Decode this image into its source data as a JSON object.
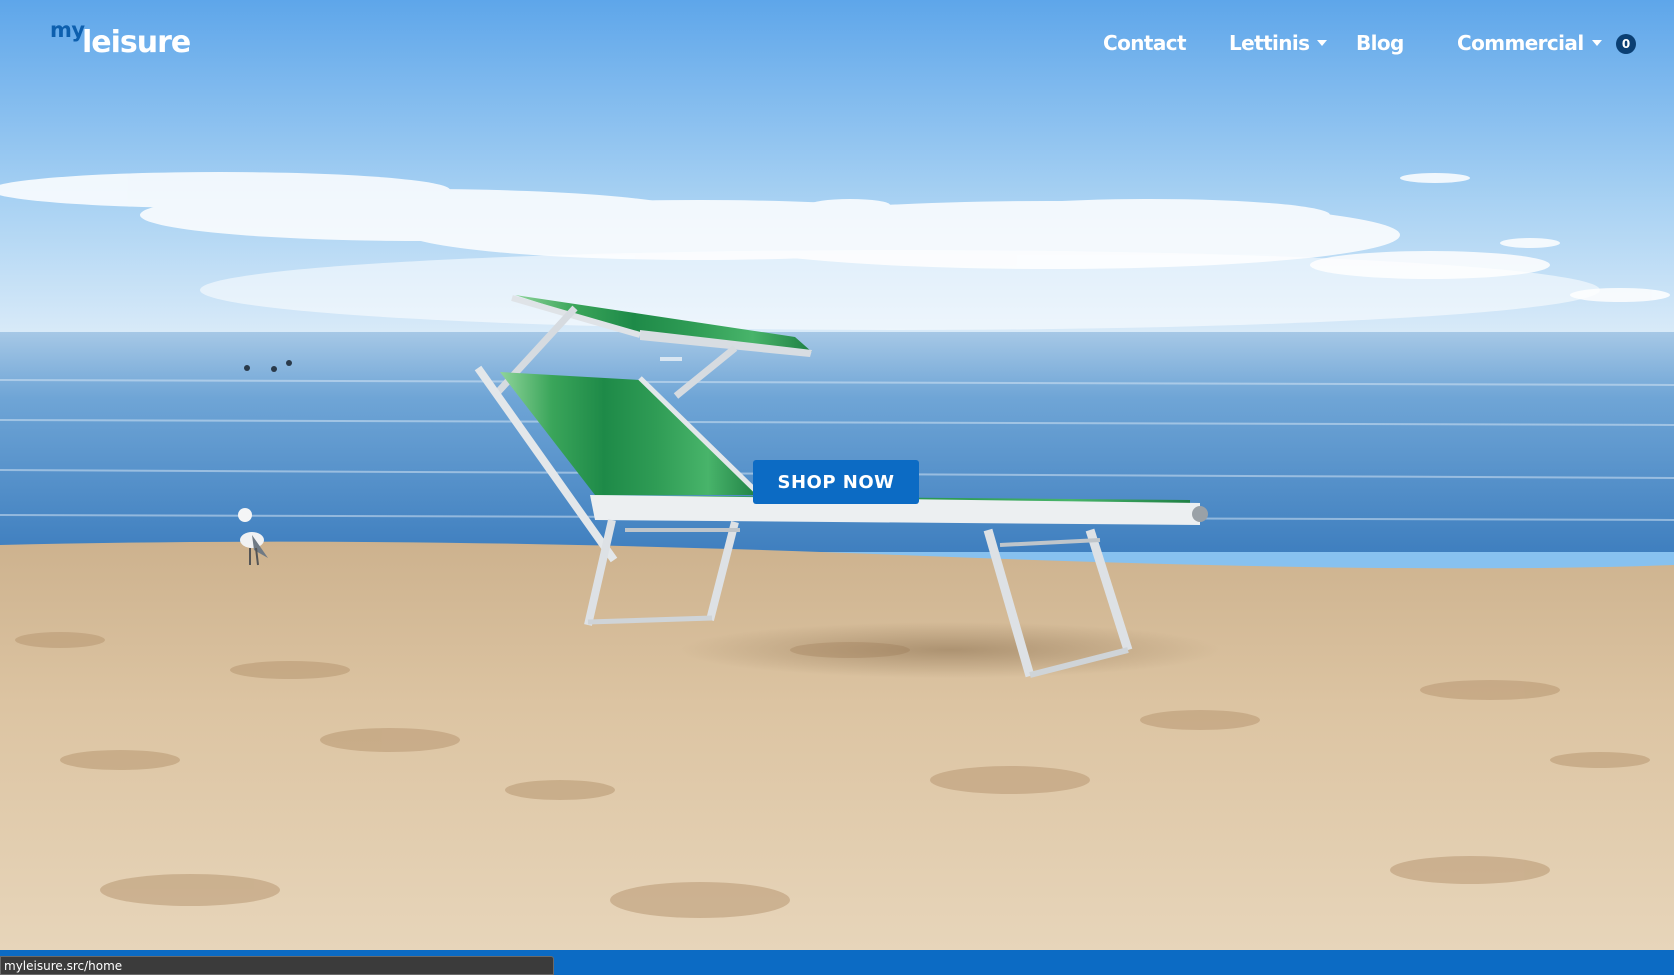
{
  "logo": {
    "prefix": "my",
    "name": "leisure"
  },
  "nav": {
    "items": [
      {
        "label": "Contact",
        "has_dropdown": false
      },
      {
        "label": "Lettinis",
        "has_dropdown": true
      },
      {
        "label": "Blog",
        "has_dropdown": false
      },
      {
        "label": "Commercial",
        "has_dropdown": true
      }
    ],
    "cart_count": "0"
  },
  "hero": {
    "cta_label": "SHOP NOW"
  },
  "status_bar": {
    "url": "myleisure.src/home"
  },
  "colors": {
    "brand_blue": "#0c6bc4",
    "cart_badge": "#0b3f73",
    "sky": "#87c1ef",
    "sea": "#5f9bd0",
    "sand": "#d9c09b"
  }
}
